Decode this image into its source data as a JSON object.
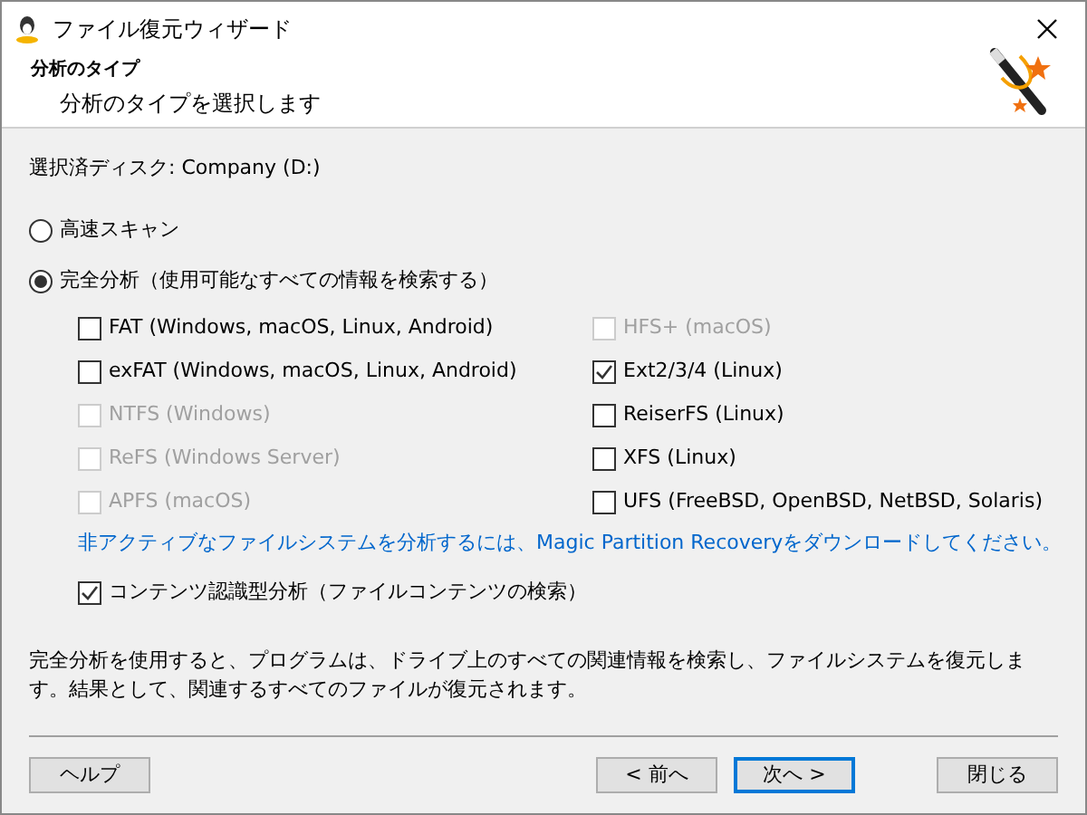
{
  "window": {
    "title": "ファイル復元ウィザード"
  },
  "header": {
    "title": "分析のタイプ",
    "subtitle": "分析のタイプを選択します"
  },
  "selected_disk": "選択済ディスク: Company (D:)",
  "scan_modes": [
    {
      "label": "高速スキャン",
      "selected": false
    },
    {
      "label": "完全分析（使用可能なすべての情報を検索する）",
      "selected": true
    }
  ],
  "filesystems_left": [
    {
      "label": "FAT (Windows, macOS, Linux, Android)",
      "checked": false,
      "disabled": false
    },
    {
      "label": "exFAT (Windows, macOS, Linux, Android)",
      "checked": false,
      "disabled": false
    },
    {
      "label": "NTFS (Windows)",
      "checked": false,
      "disabled": true
    },
    {
      "label": "ReFS (Windows Server)",
      "checked": false,
      "disabled": true
    },
    {
      "label": "APFS (macOS)",
      "checked": false,
      "disabled": true
    }
  ],
  "filesystems_right": [
    {
      "label": "HFS+ (macOS)",
      "checked": false,
      "disabled": true
    },
    {
      "label": "Ext2/3/4 (Linux)",
      "checked": true,
      "disabled": false
    },
    {
      "label": "ReiserFS (Linux)",
      "checked": false,
      "disabled": false
    },
    {
      "label": "XFS (Linux)",
      "checked": false,
      "disabled": false
    },
    {
      "label": "UFS (FreeBSD, OpenBSD, NetBSD, Solaris)",
      "checked": false,
      "disabled": false
    }
  ],
  "inactive_link": "非アクティブなファイルシステムを分析するには、Magic Partition Recoveryをダウンロードしてください。",
  "content_analysis": {
    "label": "コンテンツ認識型分析（ファイルコンテンツの検索）",
    "checked": true,
    "disabled": false
  },
  "description": "完全分析を使用すると、プログラムは、ドライブ上のすべての関連情報を検索し、ファイルシステムを復元します。結果として、関連するすべてのファイルが復元されます。",
  "buttons": [
    {
      "label": "ヘルプ",
      "kind": "help",
      "focused": false
    },
    {
      "label": "< 前へ",
      "kind": "nav",
      "focused": false
    },
    {
      "label": "次へ >",
      "kind": "nav",
      "focused": true
    },
    {
      "label": "閉じる",
      "kind": "close",
      "focused": false
    }
  ]
}
